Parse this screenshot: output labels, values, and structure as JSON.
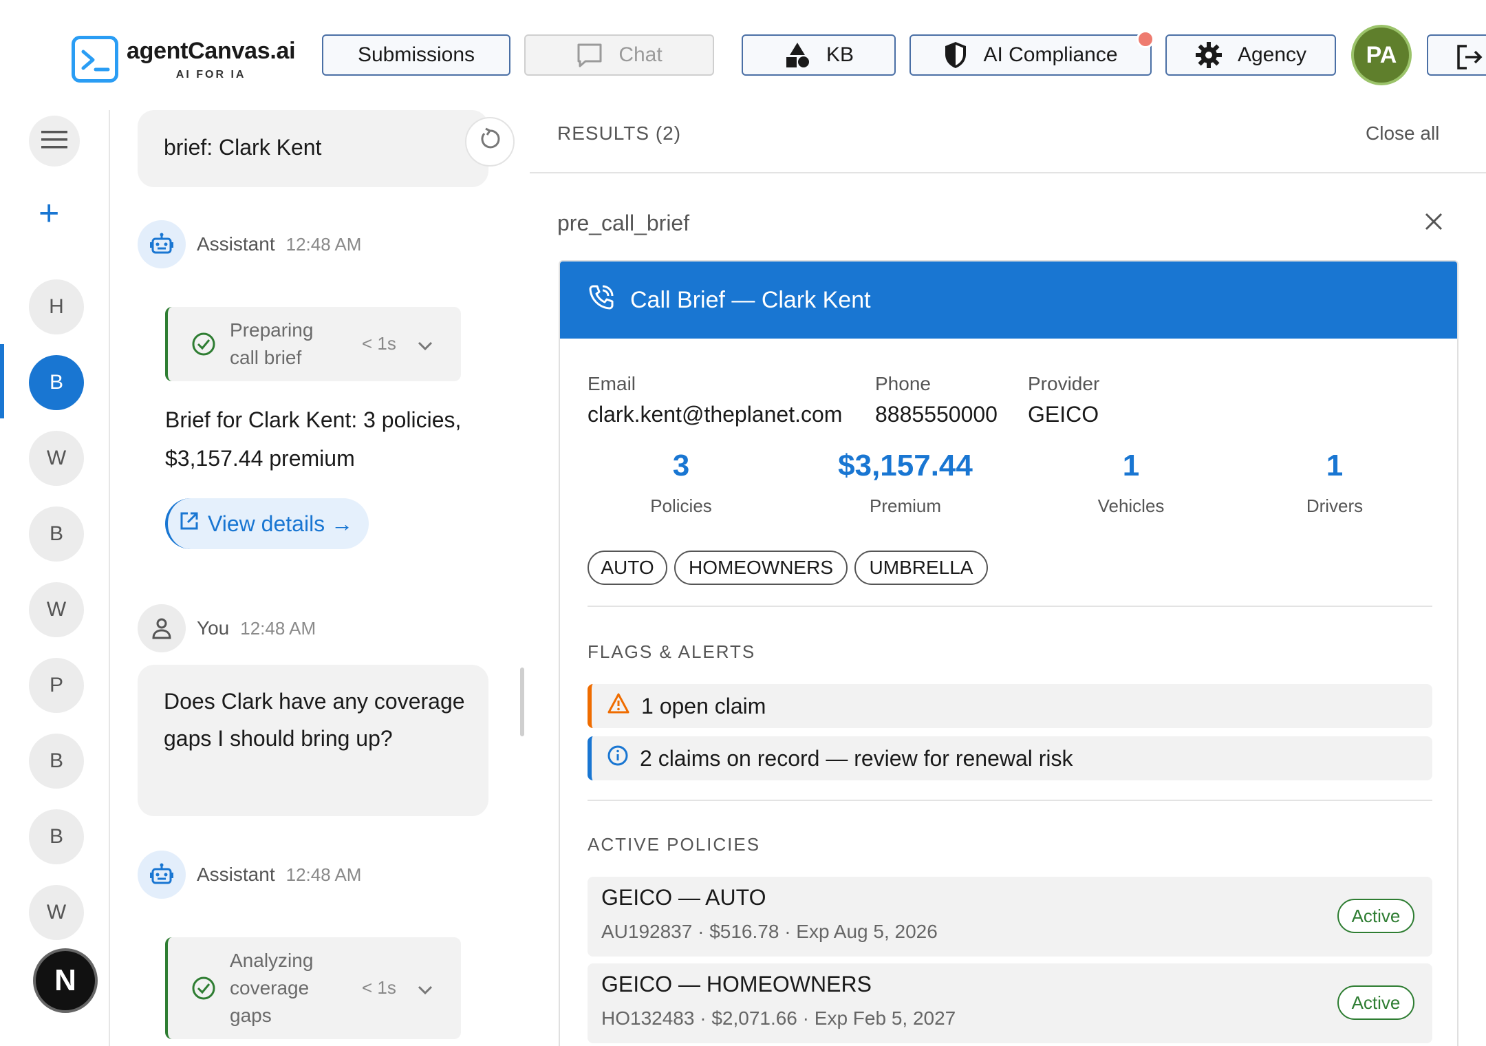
{
  "logo": {
    "title": "agentCanvas.ai",
    "subtitle": "AI FOR IA"
  },
  "nav": {
    "submissions": "Submissions",
    "chat": "Chat",
    "kb": "KB",
    "compliance": "AI Compliance",
    "agency": "Agency",
    "avatar": "PA"
  },
  "rail": {
    "items": [
      "H",
      "B",
      "W",
      "B",
      "W",
      "P",
      "B",
      "B",
      "W"
    ],
    "active_index": 1,
    "bottom_badge": "N"
  },
  "chat": {
    "query": "brief: Clark Kent",
    "messages": [
      {
        "author": "Assistant",
        "time": "12:48 AM"
      },
      {
        "author": "You",
        "time": "12:48 AM"
      },
      {
        "author": "Assistant",
        "time": "12:48 AM"
      }
    ],
    "step1": {
      "label_line1": "Preparing",
      "label_line2": "call brief",
      "duration": "< 1s"
    },
    "brief_summary": "Brief for Clark Kent: 3 policies, $3,157.44 premium",
    "view_details": "View details →",
    "user_question": "Does Clark have any coverage gaps I should bring up?",
    "step2": {
      "label_line1": "Analyzing",
      "label_line2": "coverage",
      "label_line3": "gaps",
      "duration": "< 1s"
    }
  },
  "results": {
    "title": "RESULTS (2)",
    "close_all": "Close all",
    "tool_name": "pre_call_brief",
    "card_title": "Call Brief — Clark Kent",
    "contact": {
      "email_label": "Email",
      "email": "clark.kent@theplanet.com",
      "phone_label": "Phone",
      "phone": "8885550000",
      "provider_label": "Provider",
      "provider": "GEICO"
    },
    "stats": [
      {
        "value": "3",
        "label": "Policies"
      },
      {
        "value": "$3,157.44",
        "label": "Premium"
      },
      {
        "value": "1",
        "label": "Vehicles"
      },
      {
        "value": "1",
        "label": "Drivers"
      }
    ],
    "lines": [
      "AUTO",
      "HOMEOWNERS",
      "UMBRELLA"
    ],
    "flags_title": "FLAGS & ALERTS",
    "flags": [
      {
        "type": "warning",
        "text": "1 open claim"
      },
      {
        "type": "info",
        "text": "2 claims on record — review for renewal risk"
      }
    ],
    "policies_title": "ACTIVE POLICIES",
    "policies": [
      {
        "title": "GEICO — AUTO",
        "detail": "AU192837 · $516.78 · Exp Aug 5, 2026",
        "status": "Active"
      },
      {
        "title": "GEICO — HOMEOWNERS",
        "detail": "HO132483 · $2,071.66 · Exp Feb 5, 2027",
        "status": "Active"
      }
    ]
  },
  "colors": {
    "accent": "#1976d2",
    "success": "#2e7d32",
    "warning": "#ef6c00",
    "avatar": "#5f7f2c",
    "notification": "#ee7b6f"
  },
  "icons": {
    "chat": "chat-bubble-icon",
    "kb": "shapes-icon",
    "compliance": "shield-icon",
    "agency": "gear-icon",
    "logout": "logout-icon",
    "card": "phone-call-icon"
  }
}
